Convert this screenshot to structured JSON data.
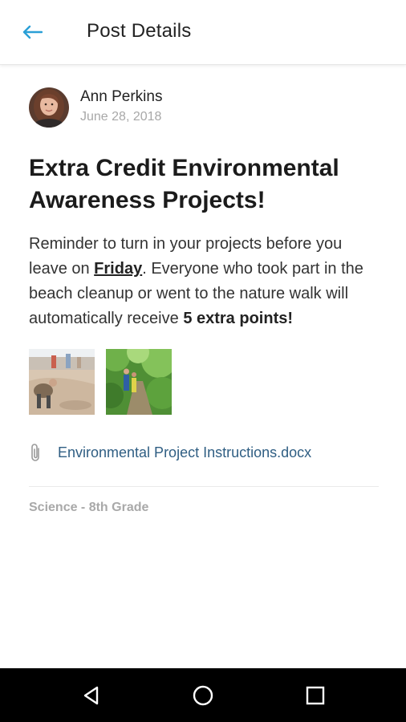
{
  "header": {
    "back_icon": "arrow-left-icon",
    "title": "Post Details",
    "accent_color": "#2a9fd6"
  },
  "post": {
    "author_name": "Ann Perkins",
    "date": "June 28, 2018",
    "title": "Extra Credit Environmental Awareness Projects!",
    "body": {
      "part1": "Reminder to turn in your projects before you leave on ",
      "underlined": "Friday",
      "part2": ". Everyone who took part in the beach cleanup or went to the nature walk will automatically receive ",
      "bold": "5 extra points!"
    },
    "attachments": [
      {
        "icon": "paperclip-icon",
        "name": "Environmental Project Instructions.docx"
      }
    ],
    "category": "Science - 8th Grade"
  },
  "system_nav": {
    "back_icon": "triangle-back-icon",
    "home_icon": "circle-home-icon",
    "recents_icon": "square-recents-icon"
  }
}
